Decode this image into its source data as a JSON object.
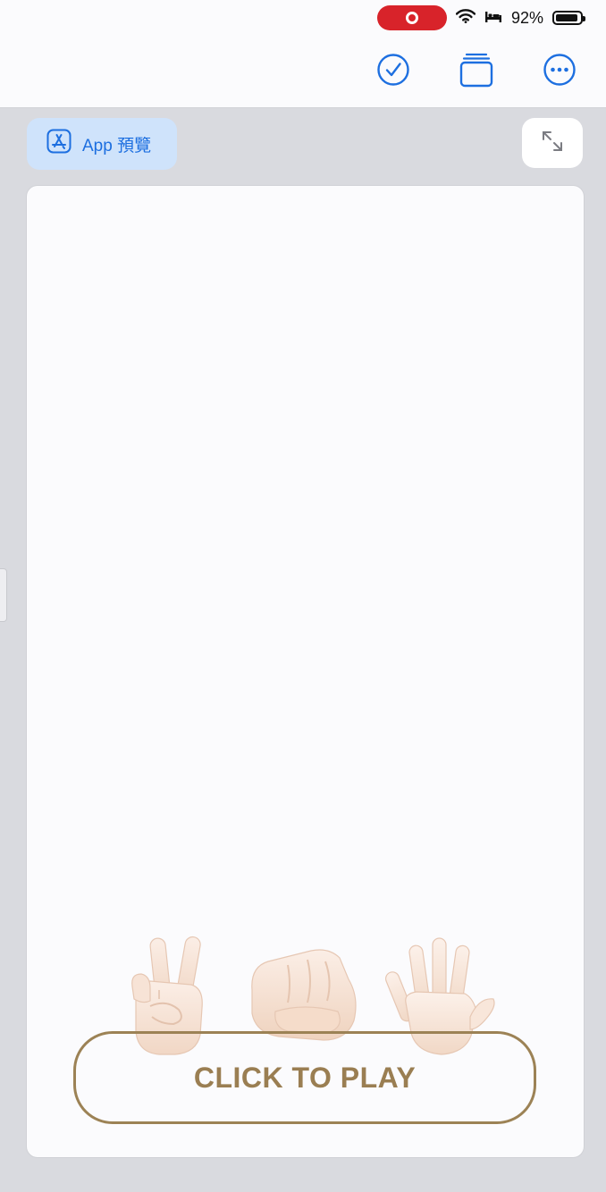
{
  "status_bar": {
    "battery_text": "92%",
    "battery_level": 0.92,
    "recording_indicator": "record-icon"
  },
  "toolbar": {
    "icons": [
      "checkmark-circle-icon",
      "stacked-windows-icon",
      "more-ellipsis-icon"
    ],
    "accent_color": "#1d6fe0"
  },
  "app_preview": {
    "label": "App 預覽"
  },
  "game": {
    "hands": [
      "peace-hand-icon",
      "fist-hand-icon",
      "open-hand-icon"
    ],
    "play_button_label": "CLICK TO PLAY",
    "play_button_color": "#9c8255"
  }
}
